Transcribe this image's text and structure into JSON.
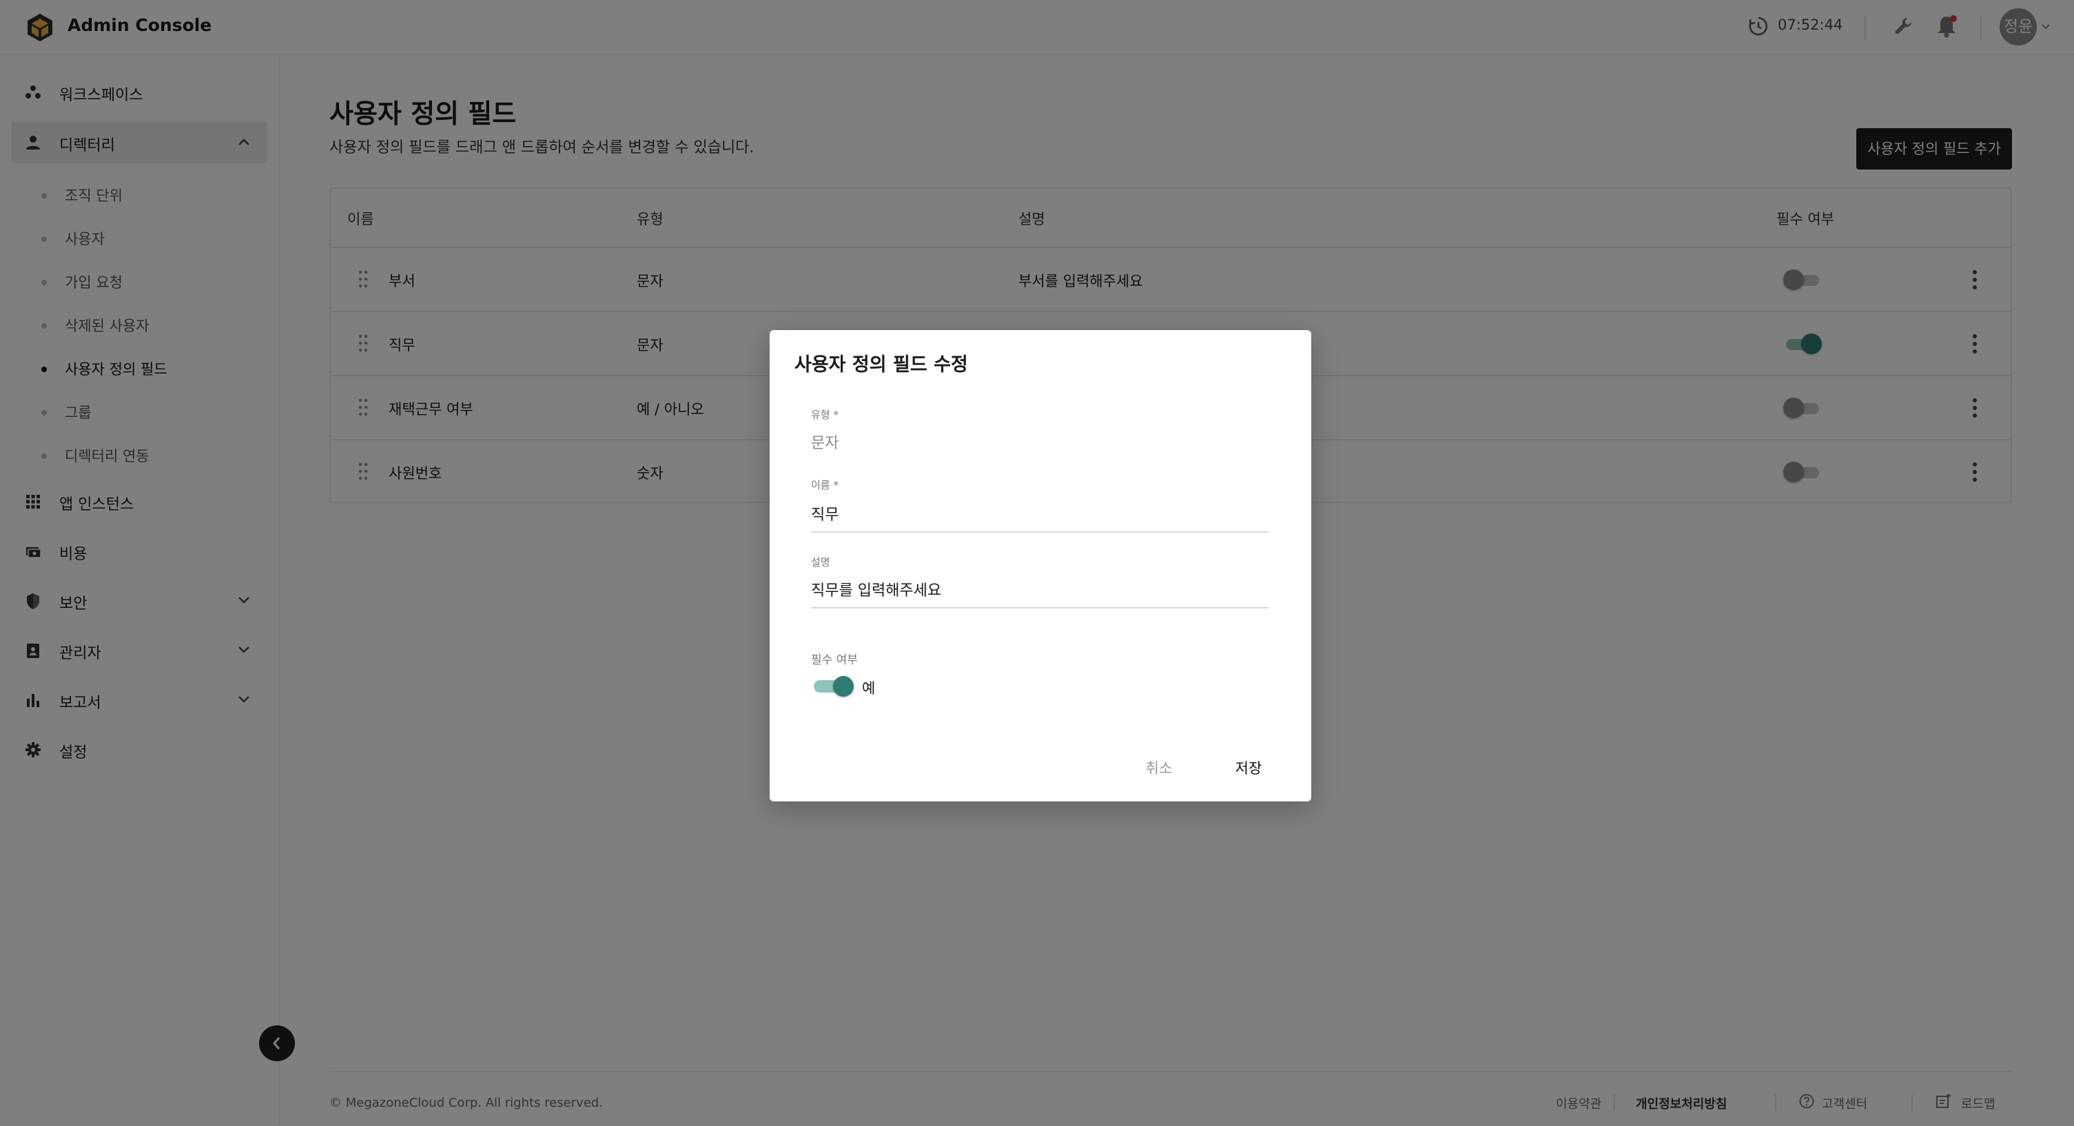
{
  "header": {
    "app_title": "Admin Console",
    "time": "07:52:44",
    "avatar_text": "정윤"
  },
  "sidebar": {
    "items": [
      {
        "label": "워크스페이스",
        "icon": "workspace-icon"
      },
      {
        "label": "디렉터리",
        "icon": "person-icon",
        "expanded": true
      },
      {
        "label": "앱 인스턴스",
        "icon": "apps-grid-icon"
      },
      {
        "label": "비용",
        "icon": "money-icon"
      },
      {
        "label": "보안",
        "icon": "shield-icon"
      },
      {
        "label": "관리자",
        "icon": "admin-badge-icon"
      },
      {
        "label": "보고서",
        "icon": "bar-chart-icon"
      },
      {
        "label": "설정",
        "icon": "gear-icon"
      }
    ],
    "sub_items": [
      "조직 단위",
      "사용자",
      "가입 요청",
      "삭제된 사용자",
      "사용자 정의 필드",
      "그룹",
      "디렉터리 연동"
    ],
    "active_sub_item": "사용자 정의 필드"
  },
  "main": {
    "title": "사용자 정의 필드",
    "description": "사용자 정의 필드를 드래그 앤 드롭하여 순서를 변경할 수 있습니다.",
    "add_button": "사용자 정의 필드 추가",
    "table": {
      "headers": [
        "이름",
        "유형",
        "설명",
        "필수 여부"
      ],
      "rows": [
        {
          "name": "부서",
          "type": "문자",
          "description": "부서를 입력해주세요",
          "required": false
        },
        {
          "name": "직무",
          "type": "문자",
          "description": "",
          "required": true
        },
        {
          "name": "재택근무 여부",
          "type": "예 / 아니오",
          "description": "",
          "required": false
        },
        {
          "name": "사원번호",
          "type": "숫자",
          "description": "",
          "required": false
        }
      ]
    }
  },
  "footer": {
    "copyright": "© MegazoneCloud Corp. All rights reserved.",
    "terms": "이용약관",
    "privacy": "개인정보처리방침",
    "support": "고객센터",
    "roadmap": "로드맵"
  },
  "dialog": {
    "title": "사용자 정의 필드 수정",
    "type_label": "유형 *",
    "type_value": "문자",
    "name_label": "이름 *",
    "name_value": "직무",
    "desc_label": "설명",
    "desc_value": "직무를 입력해주세요",
    "required_label": "필수 여부",
    "required_on": true,
    "required_text": "예",
    "cancel": "취소",
    "save": "저장"
  },
  "colors": {
    "accent": "#2e7d74",
    "dark_button": "#1e1e1e"
  }
}
